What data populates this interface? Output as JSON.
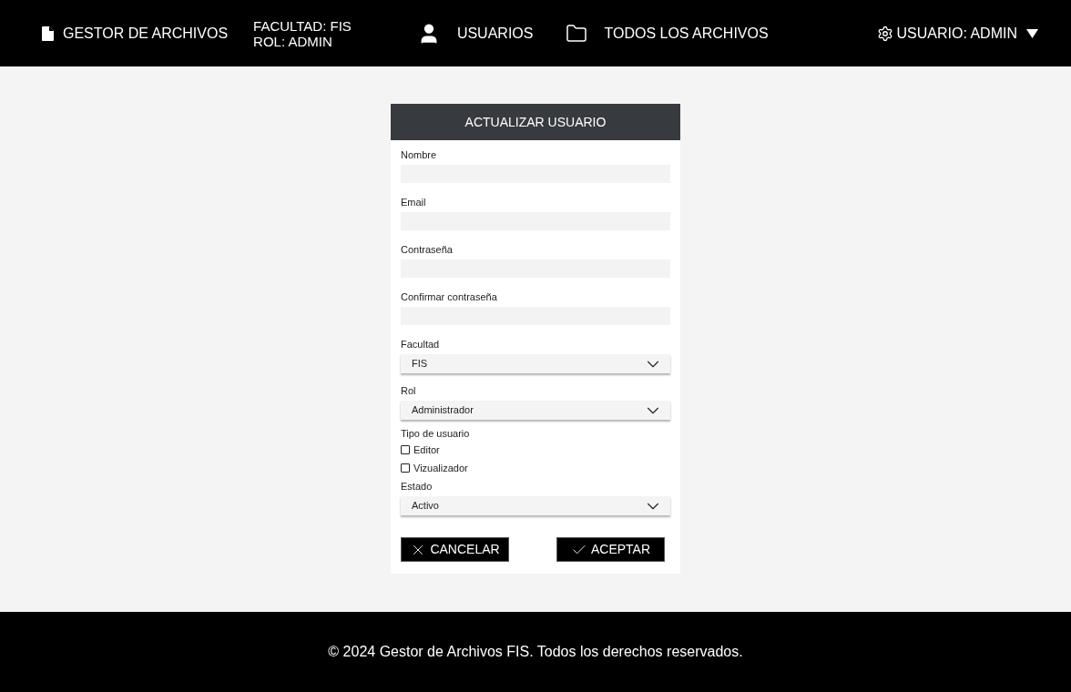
{
  "header": {
    "brand": "GESTOR DE ARCHIVOS",
    "faculty_line": "FACULTAD: FIS",
    "role_line": "ROL: ADMIN",
    "nav": [
      {
        "kind": "users",
        "label": "USUARIOS"
      },
      {
        "kind": "files",
        "label": "TODOS LOS ARCHIVOS"
      }
    ],
    "user_menu": "USUARIO: ADMIN"
  },
  "form": {
    "title": "ACTUALIZAR USUARIO",
    "fields": [
      {
        "kind": "text",
        "label": "Nombre"
      },
      {
        "kind": "text",
        "label": "Email"
      },
      {
        "kind": "text",
        "label": "Contraseña"
      },
      {
        "kind": "text",
        "label": "Confirmar contraseña"
      },
      {
        "kind": "select",
        "label": "Facultad",
        "value": "FIS"
      },
      {
        "kind": "select",
        "label": "Rol",
        "value": "Administrador"
      },
      {
        "kind": "checkboxes",
        "label": "Tipo de usuario",
        "options": [
          {
            "label": "Editor",
            "checked": false
          },
          {
            "label": "Vizualizador",
            "checked": false
          }
        ]
      },
      {
        "kind": "select",
        "label": "Estado",
        "value": "Activo"
      }
    ],
    "buttons": [
      {
        "kind": "cancel",
        "label": "CANCELAR"
      },
      {
        "kind": "accept",
        "label": "ACEPTAR"
      }
    ]
  },
  "footer": "© 2024 Gestor de Archivos FIS. Todos los derechos reservados."
}
